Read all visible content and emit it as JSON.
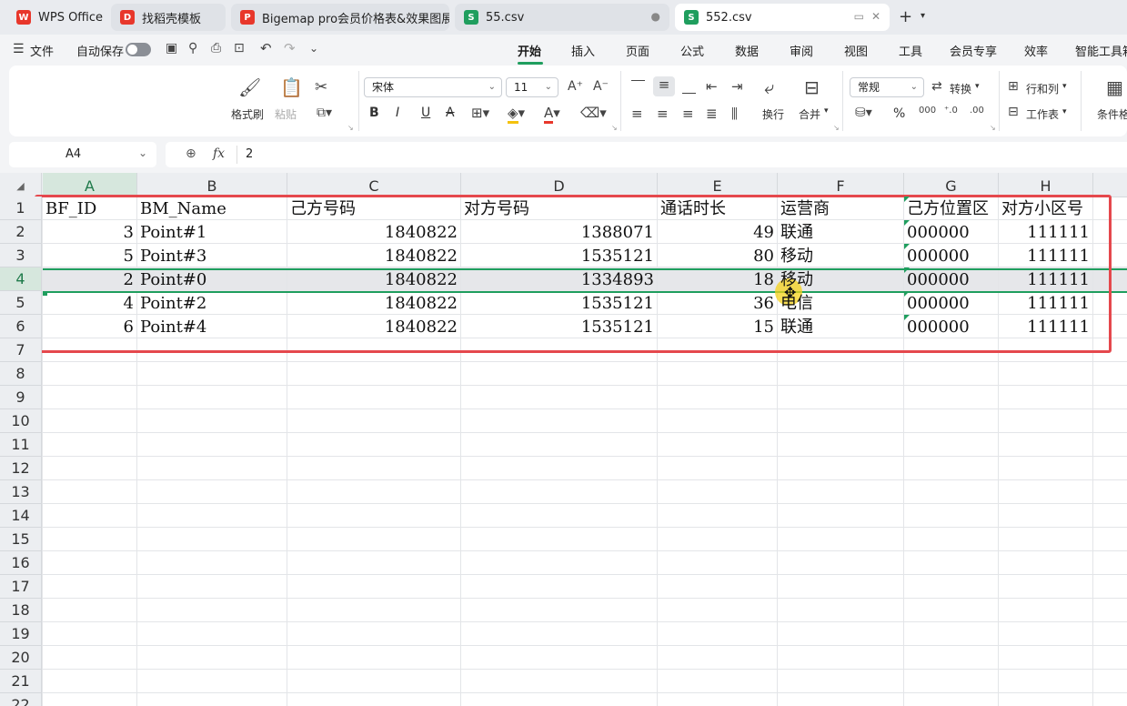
{
  "tabs": [
    {
      "label": "WPS Office",
      "icon": "wps-logo-icon",
      "color": "#e8372b"
    },
    {
      "label": "找稻壳模板",
      "icon": "docer-icon",
      "color": "#e8372b"
    },
    {
      "label": "Bigemap pro会员价格表&效果图展",
      "icon": "pdf-icon",
      "color": "#e8372b"
    },
    {
      "label": "55.csv",
      "icon": "sheet-icon",
      "color": "#1f9e5e"
    },
    {
      "label": "552.csv",
      "icon": "sheet-icon",
      "color": "#1f9e5e"
    }
  ],
  "menu": {
    "file": "文件",
    "autosave": "自动保存",
    "items": [
      "开始",
      "插入",
      "页面",
      "公式",
      "数据",
      "审阅",
      "视图",
      "工具",
      "会员专享",
      "效率",
      "智能工具箱"
    ]
  },
  "ribbon": {
    "format_painter": "格式刷",
    "paste": "粘贴",
    "font_name": "宋体",
    "font_size": "11",
    "bold": "B",
    "italic": "I",
    "underline": "U",
    "strike": "A",
    "wrap": "换行",
    "merge": "合并",
    "number_format": "常规",
    "convert": "转换",
    "rows_cols": "行和列",
    "worksheet": "工作表",
    "conditional": "条件格式",
    "percent": "%"
  },
  "formula_bar": {
    "cell_ref": "A4",
    "fx": "fx",
    "value": "2"
  },
  "columns": [
    "A",
    "B",
    "C",
    "D",
    "E",
    "F",
    "G",
    "H"
  ],
  "row_numbers": [
    "1",
    "2",
    "3",
    "4",
    "5",
    "6",
    "7",
    "8",
    "9",
    "10",
    "11",
    "12",
    "13",
    "14",
    "15",
    "16",
    "17",
    "18",
    "19",
    "20",
    "21",
    "22"
  ],
  "headers": [
    "BF_ID",
    "BM_Name",
    "己方号码",
    "对方号码",
    "通话时长",
    "运营商",
    "己方位置区",
    "对方小区号"
  ],
  "rows": [
    [
      "3",
      "Point#1",
      "1840822",
      "1388071",
      "49",
      "联通",
      "000000",
      "111111"
    ],
    [
      "5",
      "Point#3",
      "1840822",
      "1535121",
      "80",
      "移动",
      "000000",
      "111111"
    ],
    [
      "2",
      "Point#0",
      "1840822",
      "1334893",
      "18",
      "移动",
      "000000",
      "111111"
    ],
    [
      "4",
      "Point#2",
      "1840822",
      "1535121",
      "36",
      "电信",
      "000000",
      "111111"
    ],
    [
      "6",
      "Point#4",
      "1840822",
      "1535121",
      "15",
      "联通",
      "000000",
      "111111"
    ]
  ],
  "selected_row": 4,
  "colors": {
    "accent": "#1f9e5e",
    "highlight_box": "#e5484d",
    "cursor": "#f6d21a"
  }
}
